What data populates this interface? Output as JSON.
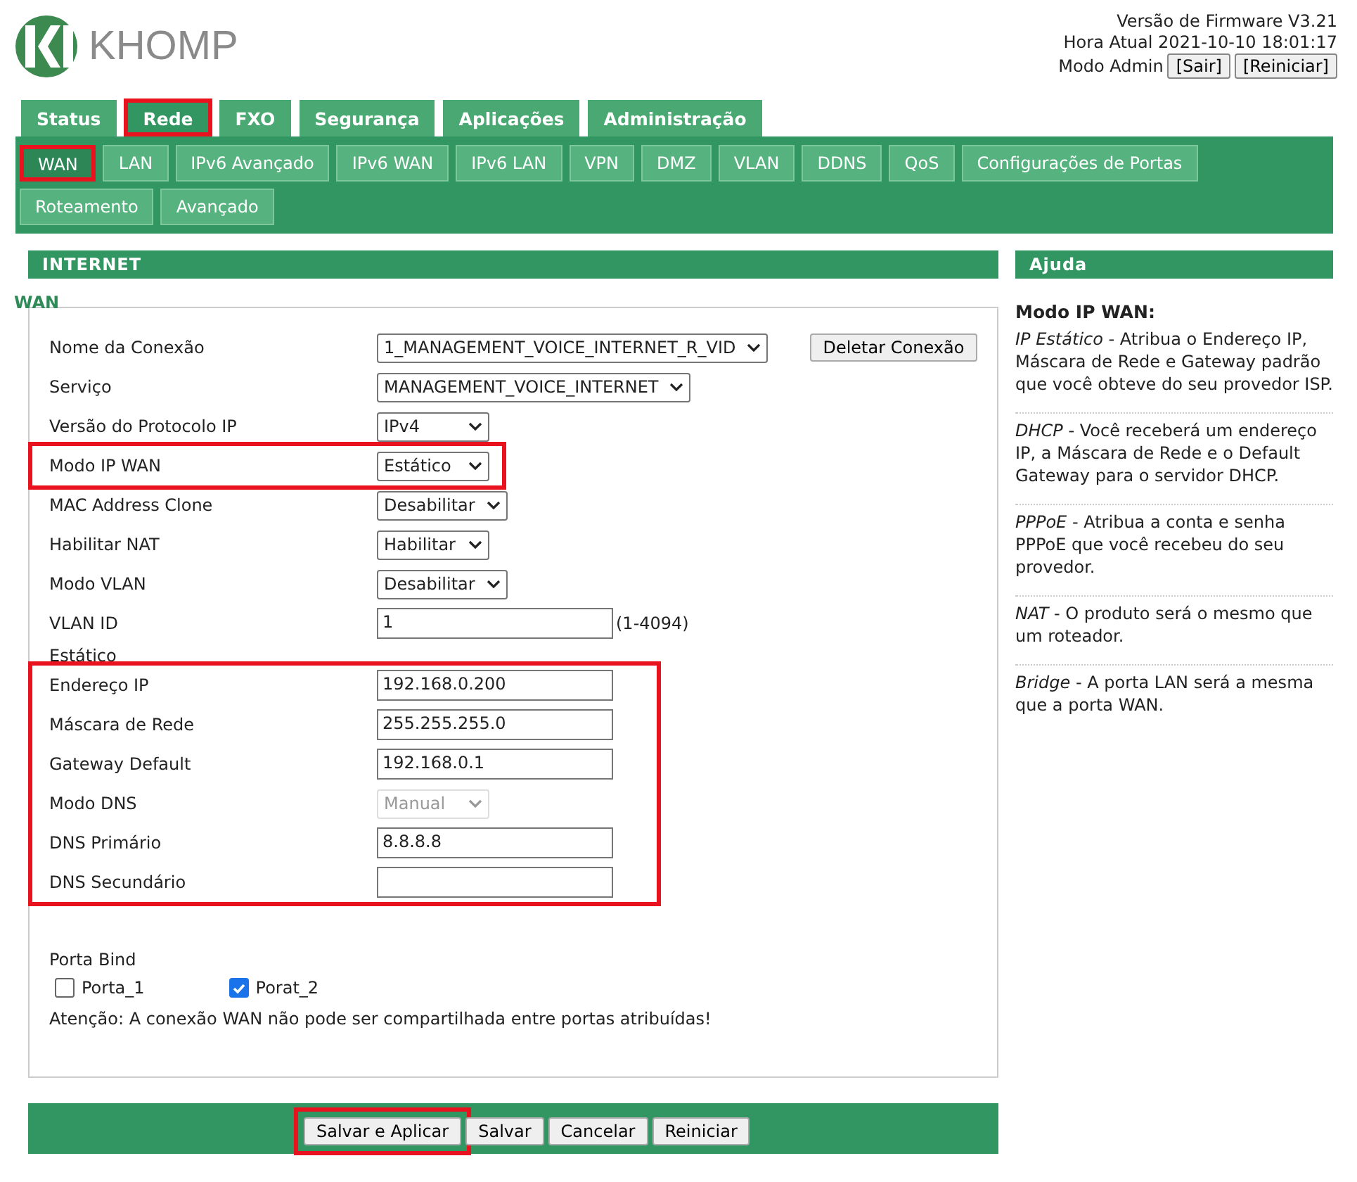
{
  "logo": {
    "text": "KHOMP"
  },
  "header_info": {
    "firmware": "Versão de Firmware V3.21",
    "time": "Hora Atual 2021-10-10 18:01:17",
    "mode": "Modo Admin",
    "buttons": [
      "[Sair]",
      "[Reiniciar]"
    ]
  },
  "tabs": [
    {
      "label": "Status",
      "selected": false,
      "highlighted": false
    },
    {
      "label": "Rede",
      "selected": true,
      "highlighted": true
    },
    {
      "label": "FXO",
      "selected": false,
      "highlighted": false
    },
    {
      "label": "Segurança",
      "selected": false,
      "highlighted": false
    },
    {
      "label": "Aplicações",
      "selected": false,
      "highlighted": false
    },
    {
      "label": "Administração",
      "selected": false,
      "highlighted": false
    }
  ],
  "subtabs": [
    {
      "label": "WAN",
      "selected": true,
      "highlighted": true
    },
    {
      "label": "LAN",
      "selected": false,
      "highlighted": false
    },
    {
      "label": "IPv6 Avançado",
      "selected": false,
      "highlighted": false
    },
    {
      "label": "IPv6 WAN",
      "selected": false,
      "highlighted": false
    },
    {
      "label": "IPv6 LAN",
      "selected": false,
      "highlighted": false
    },
    {
      "label": "VPN",
      "selected": false,
      "highlighted": false
    },
    {
      "label": "DMZ",
      "selected": false,
      "highlighted": false
    },
    {
      "label": "VLAN",
      "selected": false,
      "highlighted": false
    },
    {
      "label": "DDNS",
      "selected": false,
      "highlighted": false
    },
    {
      "label": "QoS",
      "selected": false,
      "highlighted": false
    },
    {
      "label": "Configurações de Portas",
      "selected": false,
      "highlighted": false
    },
    {
      "label": "Roteamento",
      "selected": false,
      "highlighted": false
    },
    {
      "label": "Avançado",
      "selected": false,
      "highlighted": false
    }
  ],
  "main": {
    "title": "INTERNET",
    "legend": "WAN",
    "rows": [
      {
        "label": "Nome da Conexão",
        "kind": "select",
        "value": "1_MANAGEMENT_VOICE_INTERNET_R_VID",
        "button": "Deletar Conexão",
        "highlighted": false
      },
      {
        "label": "Serviço",
        "kind": "select",
        "value": "MANAGEMENT_VOICE_INTERNET",
        "highlighted": false
      },
      {
        "label": "Versão do Protocolo IP",
        "kind": "select",
        "value": "IPv4",
        "highlighted": false
      },
      {
        "label": "Modo IP WAN",
        "kind": "select",
        "value": "Estático",
        "highlighted": true
      },
      {
        "label": "MAC Address Clone",
        "kind": "select",
        "value": "Desabilitar",
        "highlighted": false
      },
      {
        "label": "Habilitar NAT",
        "kind": "select",
        "value": "Habilitar",
        "highlighted": false
      },
      {
        "label": "Modo VLAN",
        "kind": "select",
        "value": "Desabilitar",
        "highlighted": false
      },
      {
        "label": "VLAN ID",
        "kind": "input",
        "value": "1",
        "suffix": "(1-4094)",
        "highlighted": false
      }
    ],
    "static": {
      "label": "Estático",
      "highlighted": true,
      "rows": [
        {
          "label": "Endereço IP",
          "kind": "input",
          "value": "192.168.0.200"
        },
        {
          "label": "Máscara de Rede",
          "kind": "input",
          "value": "255.255.255.0"
        },
        {
          "label": "Gateway Default",
          "kind": "input",
          "value": "192.168.0.1"
        },
        {
          "label": "Modo DNS",
          "kind": "select",
          "value": "Manual",
          "disabled": true
        },
        {
          "label": "DNS Primário",
          "kind": "input",
          "value": "8.8.8.8"
        },
        {
          "label": "DNS Secundário",
          "kind": "input",
          "value": ""
        }
      ]
    },
    "port_bind": {
      "label": "Porta Bind",
      "ports": [
        {
          "label": "Porta_1",
          "checked": false
        },
        {
          "label": "Porat_2",
          "checked": true
        }
      ]
    },
    "warning": "Atenção: A conexão WAN não pode ser compartilhada entre portas atribuídas!",
    "buttons": [
      {
        "label": "Salvar e Aplicar",
        "highlighted": true
      },
      {
        "label": "Salvar",
        "highlighted": false
      },
      {
        "label": "Cancelar",
        "highlighted": false
      },
      {
        "label": "Reiniciar",
        "highlighted": false
      }
    ]
  },
  "help": {
    "title": "Ajuda",
    "heading": "Modo IP WAN:",
    "entries": [
      "*IP Estático* - Atribua o Endereço IP, Máscara de Rede e Gateway padrão que você obteve do seu provedor ISP.",
      "*DHCP* - Você receberá um endereço IP, a Máscara de Rede e o Default Gateway para o servidor DHCP.",
      "*PPPoE* - Atribua a conta e senha PPPoE que você recebeu do seu provedor.",
      "*NAT* - O produto será o mesmo que um roteador.",
      "*Bridge* - A porta LAN será a mesma que a porta WAN."
    ]
  }
}
